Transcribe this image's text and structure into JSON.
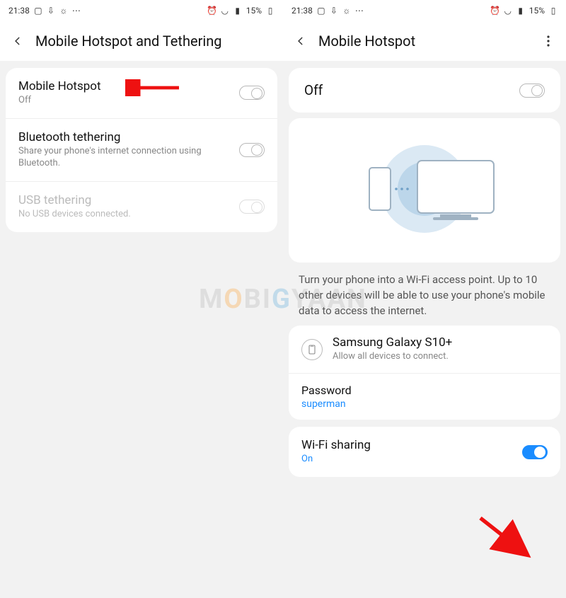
{
  "statusbar": {
    "time": "21:38",
    "battery": "15%"
  },
  "left": {
    "title": "Mobile Hotspot and Tethering",
    "rows": [
      {
        "title": "Mobile Hotspot",
        "sub": "Off"
      },
      {
        "title": "Bluetooth tethering",
        "sub": "Share your phone's internet connection using Bluetooth."
      },
      {
        "title": "USB tethering",
        "sub": "No USB devices connected."
      }
    ]
  },
  "right": {
    "title": "Mobile Hotspot",
    "off_label": "Off",
    "desc": "Turn your phone into a Wi-Fi access point. Up to 10 other devices will be able to use your phone's mobile data to access the internet.",
    "device": {
      "name": "Samsung Galaxy S10+",
      "sub": "Allow all devices to connect."
    },
    "password": {
      "label": "Password",
      "value": "superman"
    },
    "wifi_sharing": {
      "label": "Wi-Fi sharing",
      "sub": "On"
    }
  },
  "watermark": "MOBIGYAAN"
}
